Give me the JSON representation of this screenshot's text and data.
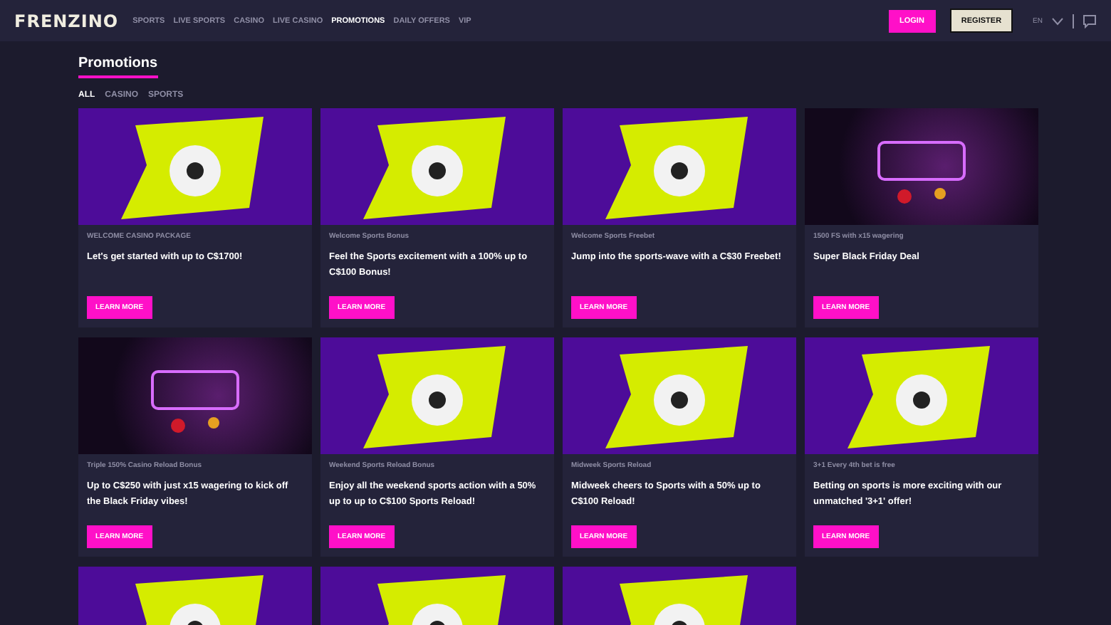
{
  "header": {
    "logo": "FRENZINO",
    "nav": [
      {
        "label": "SPORTS",
        "selected": false
      },
      {
        "label": "LIVE SPORTS",
        "selected": false
      },
      {
        "label": "CASINO",
        "selected": false
      },
      {
        "label": "LIVE CASINO",
        "selected": false
      },
      {
        "label": "PROMOTIONS",
        "selected": true
      },
      {
        "label": "DAILY OFFERS",
        "selected": false
      },
      {
        "label": "VIP",
        "selected": false
      }
    ],
    "login": "LOGIN",
    "register": "REGISTER",
    "language": "EN"
  },
  "page_title": "Promotions",
  "filters": [
    {
      "label": "ALL",
      "selected": true
    },
    {
      "label": "CASINO",
      "selected": false
    },
    {
      "label": "SPORTS",
      "selected": false
    }
  ],
  "promotions": [
    {
      "kind": "bright",
      "tag": "WELCOME CASINO PACKAGE",
      "title": "Let's get started with up to C$1700!",
      "button": "LEARN MORE"
    },
    {
      "kind": "bright",
      "tag": "Welcome Sports Bonus",
      "title": "Feel the Sports excitement with a 100% up to C$100 Bonus!",
      "button": "LEARN MORE"
    },
    {
      "kind": "bright",
      "tag": "Welcome Sports Freebet",
      "title": "Jump into the sports-wave with a C$30 Freebet!",
      "button": "LEARN MORE"
    },
    {
      "kind": "dark",
      "tag": "1500 FS with x15 wagering",
      "title": "Super Black Friday Deal",
      "button": "LEARN MORE"
    },
    {
      "kind": "dark",
      "tag": "Triple 150% Casino Reload Bonus",
      "title": "Up to C$250 with just x15 wagering to kick off the Black Friday vibes!",
      "button": "LEARN MORE"
    },
    {
      "kind": "bright",
      "tag": "Weekend Sports Reload Bonus",
      "title": "Enjoy all the weekend sports action with a 50% up to up to C$100 Sports Reload!",
      "button": "LEARN MORE"
    },
    {
      "kind": "bright",
      "tag": "Midweek Sports Reload",
      "title": "Midweek cheers to Sports with a 50% up to C$100 Reload!",
      "button": "LEARN MORE"
    },
    {
      "kind": "bright",
      "tag": "3+1 Every 4th bet is free",
      "title": "Betting on sports is more exciting with our unmatched '3+1' offer!",
      "button": "LEARN MORE"
    },
    {
      "kind": "bright"
    },
    {
      "kind": "bright"
    },
    {
      "kind": "bright"
    }
  ]
}
